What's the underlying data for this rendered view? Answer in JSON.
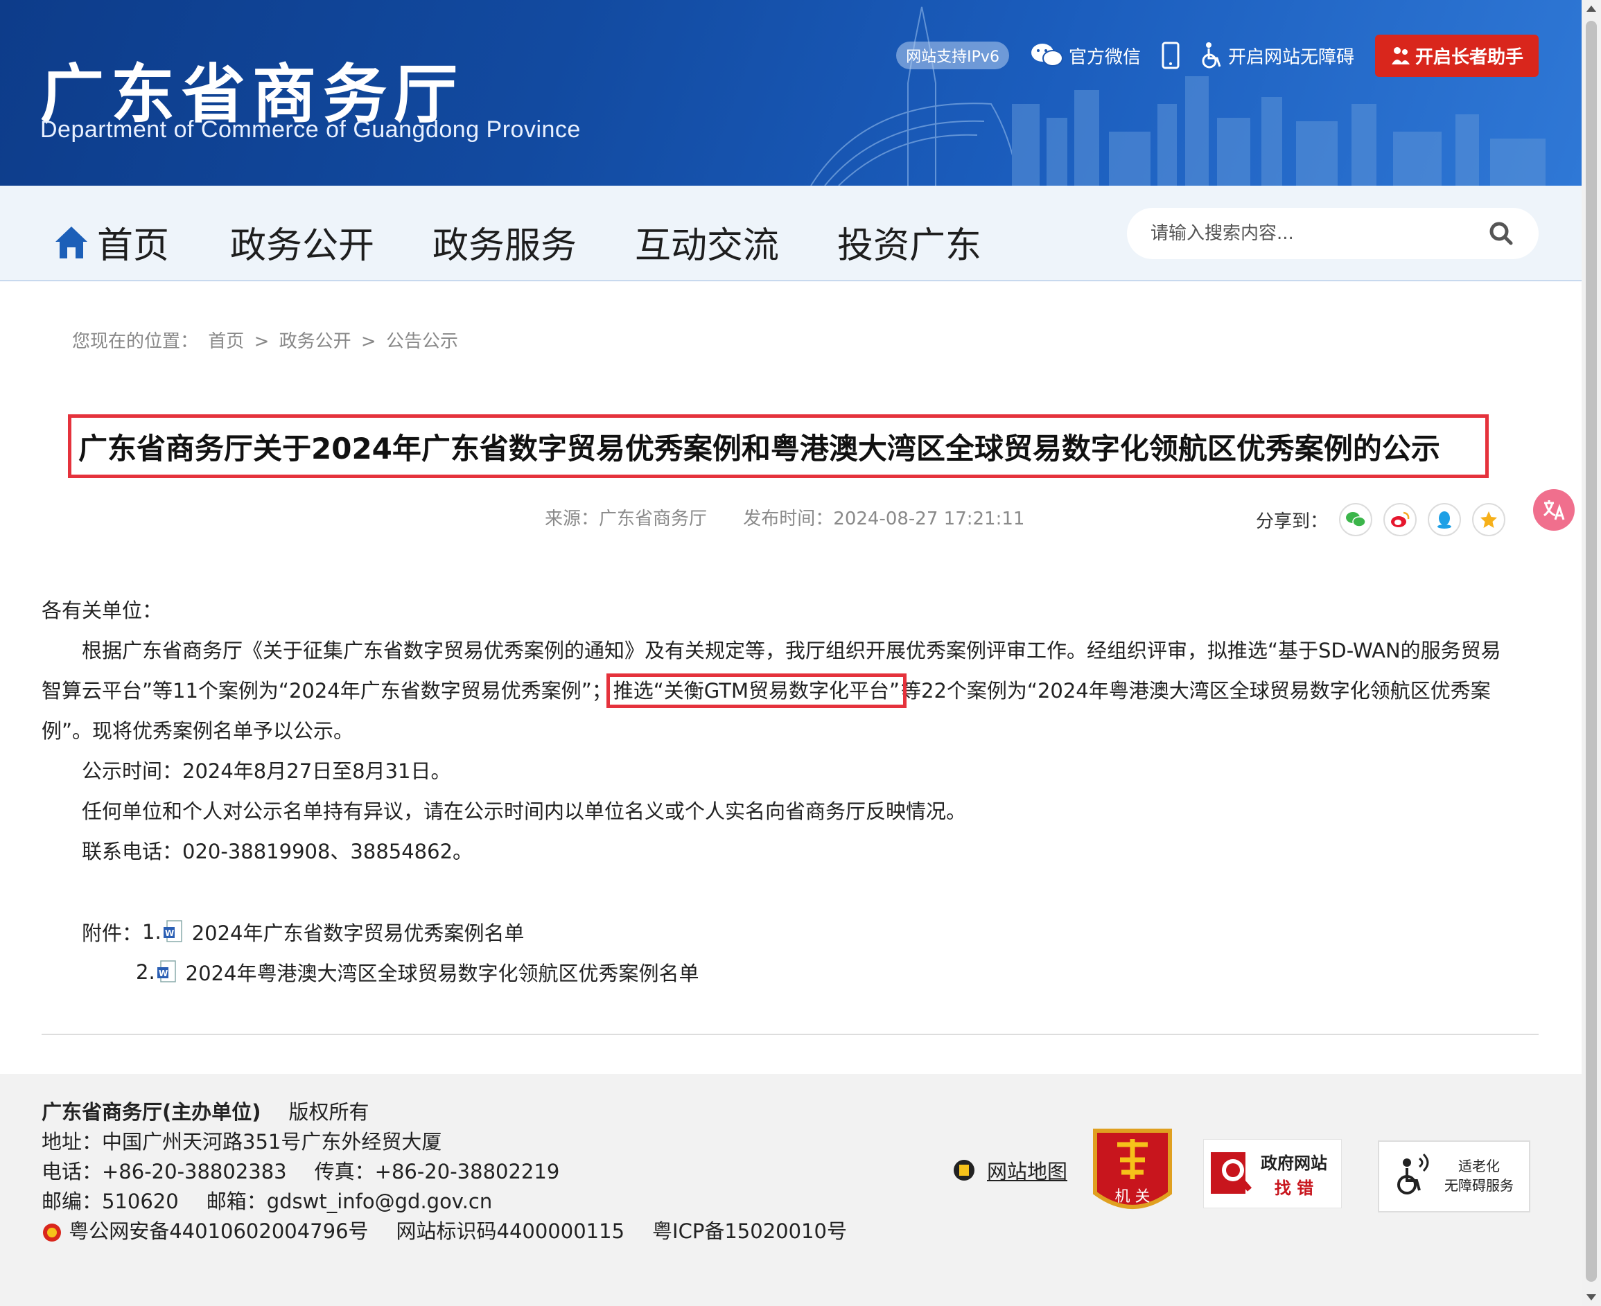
{
  "header": {
    "title": "广东省商务厅",
    "subtitle": "Department of Commerce of Guangdong Province",
    "ipv6": "网站支持IPv6",
    "wechat": "官方微信",
    "accessibility": "开启网站无障碍",
    "elder": "开启长者助手"
  },
  "nav": {
    "items": [
      "首页",
      "政务公开",
      "政务服务",
      "互动交流",
      "投资广东"
    ],
    "search_placeholder": "请输入搜索内容..."
  },
  "breadcrumb": {
    "label": "您现在的位置：",
    "items": [
      "首页",
      ">",
      "政务公开",
      ">",
      "公告公示"
    ]
  },
  "article": {
    "title": "广东省商务厅关于2024年广东省数字贸易优秀案例和粤港澳大湾区全球贸易数字化领航区优秀案例的公示",
    "source": "来源：广东省商务厅",
    "published": "发布时间：2024-08-27 17:21:11",
    "share_label": "分享到：",
    "salutation": "各有关单位：",
    "para1_a": "根据广东省商务厅《关于征集广东省数字贸易优秀案例的通知》及有关规定等，我厅组织开展优秀案例评审工作。经组织评审，拟推选“基于SD-WAN的服务贸易智算云平台”等11个案例为“2024年广东省数字贸易优秀案例”；",
    "para1_highlight": "推选“关衡GTM贸易数字化平台”",
    "para1_b": "等22个案例为“2024年粤港澳大湾区全球贸易数字化领航区优秀案例”。现将优秀案例名单予以公示。",
    "period": "公示时间：2024年8月27日至8月31日。",
    "objection": "任何单位和个人对公示名单持有异议，请在公示时间内以单位名义或个人实名向省商务厅反映情况。",
    "phone": "联系电话：020-38819908、38854862。",
    "attach_label": "附件：",
    "attachments": [
      {
        "num": "1.",
        "name": "2024年广东省数字贸易优秀案例名单"
      },
      {
        "num": "2.",
        "name": "2024年粤港澳大湾区全球贸易数字化领航区优秀案例名单"
      }
    ]
  },
  "footer": {
    "org": "广东省商务厅(主办单位)",
    "rights": "版权所有",
    "address": "地址：中国广州天河路351号广东外经贸大厦",
    "tel": "电话：+86-20-38802383",
    "fax": "传真：+86-20-38802219",
    "postcode": "邮编：510620",
    "email": "邮箱：gdswt_info@gd.gov.cn",
    "police": "粤公网安备44010602004796号",
    "site_code": "网站标识码4400000115",
    "icp": "粤ICP备15020010号",
    "sitemap": "网站地图",
    "badge_jiguan": "机 关",
    "badge_zhaocuo_1": "政府网站",
    "badge_zhaocuo_2": "找 错",
    "badge_wza_1": "适老化",
    "badge_wza_2": "无障碍服务"
  },
  "colors": {
    "header_blue": "#124aa0",
    "highlight_red": "#e5323c",
    "elder_red": "#d9261c"
  }
}
